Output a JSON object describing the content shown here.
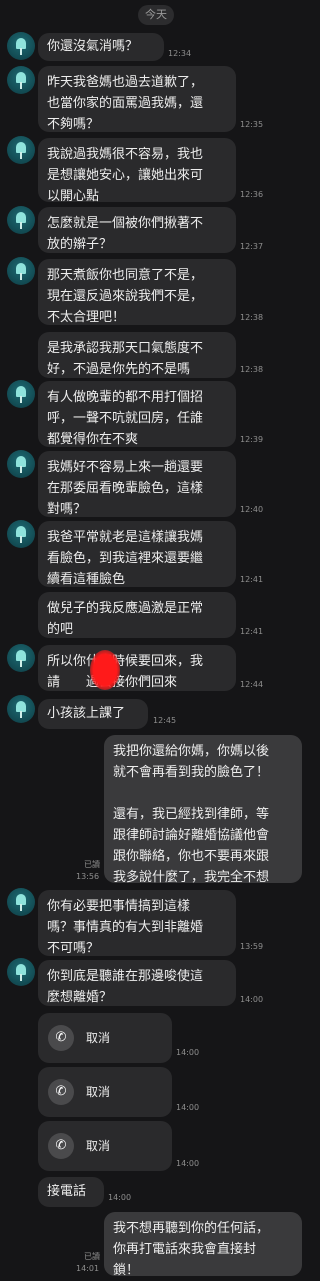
{
  "date_label": "今天",
  "messages": [
    {
      "text": "你還沒氣消嗎？",
      "time": "12:34"
    },
    {
      "text": "昨天我爸媽也過去道歉了，\n也當你家的面罵過我媽，還\n不夠嗎？",
      "time": "12:35"
    },
    {
      "text": "我說過我媽很不容易，我也\n是想讓她安心，讓她出來可\n以開心點",
      "time": "12:36"
    },
    {
      "text": "怎麼就是一個被你們揪著不\n放的辮子？",
      "time": "12:37"
    },
    {
      "text": "那天煮飯你也同意了不是，\n現在還反過來說我們不是，\n不太合理吧！",
      "time": "12:38"
    },
    {
      "text": "是我承認我那天口氣態度不\n好，不過是你先的不是嗎",
      "time": "12:38"
    },
    {
      "text": "有人做晚輩的都不用打個招\n呼，一聲不吭就回房，任誰\n都覺得你在不爽",
      "time": "12:39"
    },
    {
      "text": "我媽好不容易上來一趟還要\n在那委屈看晚輩臉色，這樣\n對嗎？",
      "time": "12:40"
    },
    {
      "text": "我爸平常就老是這樣讓我媽\n看臉色，到我這裡來還要繼\n續看這種臉色",
      "time": "12:41"
    },
    {
      "text": "做兒子的我反應過激是正常\n的吧",
      "time": "12:41"
    },
    {
      "text": "所以你什麼時候要回來，我\n請　　過去接你們回來",
      "time": "12:44"
    },
    {
      "text": "小孩該上課了",
      "time": "12:45"
    },
    {
      "text": "我把你還給你媽，你媽以後\n就不會再看到我的臉色了！\n\n還有，我已經找到律師，等\n跟律師討論好離婚協議他會\n跟你聯絡，你也不要再來跟\n我多說什麼了，我完全不想\n再聽！",
      "read": "已讀",
      "time": "13:56"
    },
    {
      "text": "你有必要把事情搞到這樣\n嗎？事情真的有大到非離婚\n不可嗎？",
      "time": "13:59"
    },
    {
      "text": "你到底是聽誰在那邊唆使這\n麼想離婚？",
      "time": "14:00"
    },
    {
      "text": "接電話",
      "time": "14:00"
    },
    {
      "text": "我不想再聽到你的任何話，\n你再打電話來我會直接封\n鎖！",
      "read": "已讀",
      "time": "14:01"
    }
  ],
  "calls": [
    {
      "label": "取消",
      "time": "14:00",
      "icon": "phone-icon"
    },
    {
      "label": "取消",
      "time": "14:00",
      "icon": "phone-icon"
    },
    {
      "label": "取消",
      "time": "14:00",
      "icon": "phone-icon"
    }
  ],
  "colors": {
    "background": "#151517",
    "bubble_in": "#2a2a2c",
    "bubble_out": "#3a3a3c",
    "redaction": "#ff1a1a"
  }
}
